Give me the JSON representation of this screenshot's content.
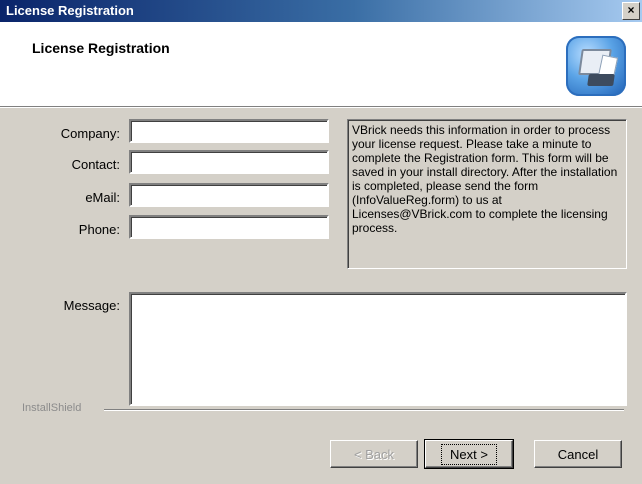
{
  "window": {
    "title": "License Registration",
    "close_glyph": "×"
  },
  "header": {
    "title": "License Registration",
    "icon": "computer-install-icon"
  },
  "form": {
    "company_label": "Company:",
    "contact_label": "Contact:",
    "email_label": "eMail:",
    "phone_label": "Phone:",
    "message_label": "Message:",
    "company_value": "",
    "contact_value": "",
    "email_value": "",
    "phone_value": "",
    "message_value": ""
  },
  "info_text": "VBrick needs this information in order to process your license request.  Please take a minute to complete the Registration form. This form will be saved in your install directory.  After the installation is completed, please send the form (InfoValueReg.form) to us at Licenses@VBrick.com to complete the licensing process.",
  "footer": {
    "brand": "InstallShield"
  },
  "buttons": {
    "back": "< Back",
    "next": "Next >",
    "cancel": "Cancel"
  }
}
